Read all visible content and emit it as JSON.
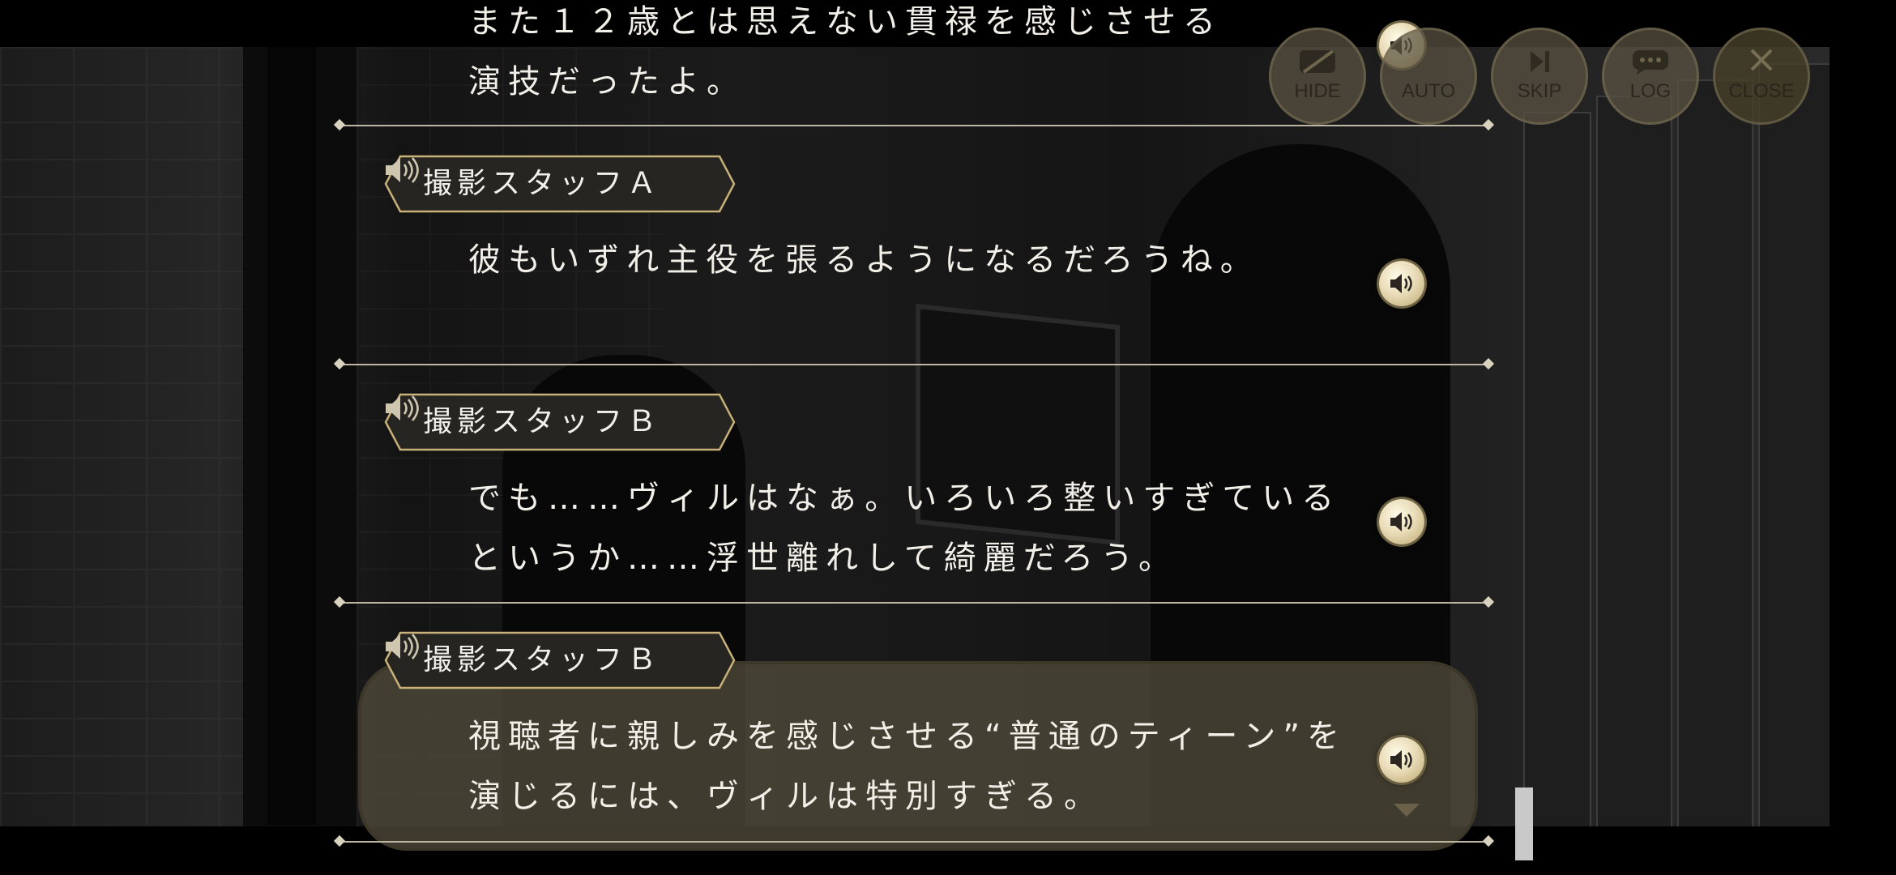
{
  "controls": {
    "hide": "HIDE",
    "auto": "AUTO",
    "skip": "SKIP",
    "log": "LOG",
    "close": "CLOSE"
  },
  "entries": [
    {
      "speaker": "",
      "lines": [
        "また１２歳とは思えない貫禄を感じさせる",
        "演技だったよ。"
      ]
    },
    {
      "speaker": "撮影スタッフＡ",
      "lines": [
        "彼もいずれ主役を張るようになるだろうね。"
      ]
    },
    {
      "speaker": "撮影スタッフＢ",
      "lines": [
        "でも……ヴィルはなぁ。いろいろ整いすぎている",
        "というか……浮世離れして綺麗だろう。"
      ]
    },
    {
      "speaker": "撮影スタッフＢ",
      "lines": [
        "視聴者に親しみを感じさせる“普通のティーン”を",
        "演じるには、ヴィルは特別すぎる。"
      ],
      "highlighted": true
    }
  ],
  "icons": {
    "voice": "speaker-icon",
    "hide": "hide-icon",
    "skip": "skip-icon",
    "log": "chat-bubble-icon",
    "close": "close-icon",
    "more": "chevron-down-icon"
  },
  "colors": {
    "accent_gold": "#c9b27a",
    "tag_bg": "#2a2925",
    "panel": "#504a3a"
  }
}
